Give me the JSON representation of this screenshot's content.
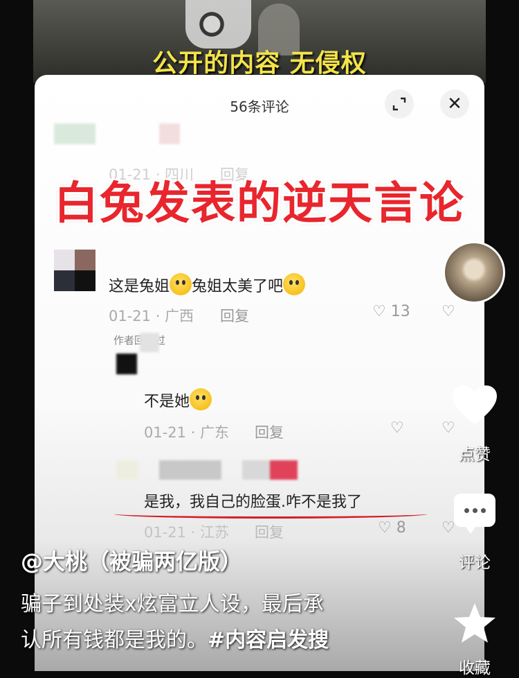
{
  "video": {
    "caption": "公开的内容 无侵权",
    "overlay_headline": "白兔发表的逆天言论"
  },
  "panel": {
    "title": "56条评论",
    "expand_icon": "expand-icon",
    "close_icon": "close-icon",
    "close_glyph": "✕"
  },
  "comments": {
    "top_partial": {
      "meta": "01-21 · 四川",
      "reply": "回复"
    },
    "main": {
      "text_a": "这是兔姐",
      "text_b": "兔姐太美了吧",
      "meta": "01-21 · 广西",
      "reply": "回复",
      "likes": "13",
      "author_replied": "作者回复过"
    },
    "reply1": {
      "text": "不是她",
      "meta": "01-21 · 广东",
      "reply": "回复"
    },
    "reply2": {
      "text": "是我，我自己的脸蛋.咋不是我了",
      "meta": "01-21 · 江苏",
      "reply": "回复",
      "likes": "8"
    }
  },
  "rail": {
    "like_label": "点赞",
    "comment_label": "评论",
    "favorite_label": "收藏"
  },
  "post": {
    "author": "@大桃（被骗两亿版）",
    "line1": "骗子到处装x炫富立人设，最后承",
    "line2_a": "认所有钱都是我的。",
    "line2_b": "#内容启发搜"
  },
  "colors": {
    "caption_yellow": "#f3e44a",
    "headline_red": "#e8262d",
    "underline_red": "#d21e25"
  }
}
